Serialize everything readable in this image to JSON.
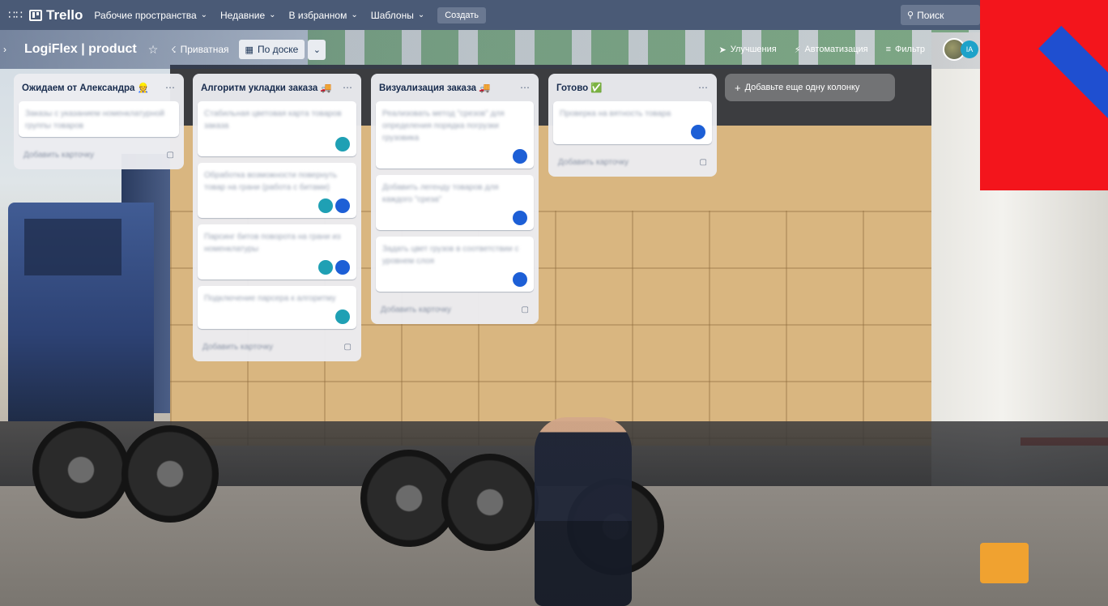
{
  "header": {
    "logo": "Trello",
    "nav": [
      {
        "label": "Рабочие пространства"
      },
      {
        "label": "Недавние"
      },
      {
        "label": "В избранном"
      },
      {
        "label": "Шаблоны"
      }
    ],
    "create_label": "Создать",
    "search_placeholder": "Поиск",
    "color": "#4a5a76"
  },
  "board": {
    "title": "LogiFlex | product",
    "visibility": "Приватная",
    "view_label": "По доске",
    "actions": {
      "upgrades": "Улучшения",
      "automation": "Автоматизация",
      "filter": "Фильтр"
    },
    "member_initials": "IA"
  },
  "lists": [
    {
      "title": "Ожидаем от Александра 👷",
      "cards": [
        {
          "text": "Заказы с указанием номенклатурной группы товаров",
          "members": []
        }
      ],
      "add_card": "Добавить карточку"
    },
    {
      "title": "Алгоритм укладки заказа 🚚",
      "cards": [
        {
          "text": "Стабильная цветовая карта товаров заказа",
          "members": [
            "teal"
          ]
        },
        {
          "text": "Обработка возможности повернуть товар на грани (работа с битами)",
          "members": [
            "teal",
            "blue"
          ]
        },
        {
          "text": "Парсинг битов поворота на грани из номенклатуры",
          "members": [
            "teal",
            "blue"
          ]
        },
        {
          "text": "Подключение парсера к алгоритму",
          "members": [
            "teal"
          ]
        }
      ],
      "add_card": "Добавить карточку"
    },
    {
      "title": "Визуализация заказа 🚚",
      "cards": [
        {
          "text": "Реализовать метод \"срезов\" для определения порядка погрузки грузовика",
          "members": [
            "blue"
          ]
        },
        {
          "text": "Добавить легенду товаров для каждого \"среза\"",
          "members": [
            "blue"
          ]
        },
        {
          "text": "Задать цвет грузов в соответствии с уровнем слоя",
          "members": [
            "blue"
          ]
        }
      ],
      "add_card": "Добавить карточку"
    },
    {
      "title": "Готово ✅",
      "cards": [
        {
          "text": "Проверка на вятность товара",
          "members": [
            "blue"
          ]
        }
      ],
      "add_card": "Добавить карточку"
    }
  ],
  "add_list_label": "Добавьте еще одну колонку"
}
